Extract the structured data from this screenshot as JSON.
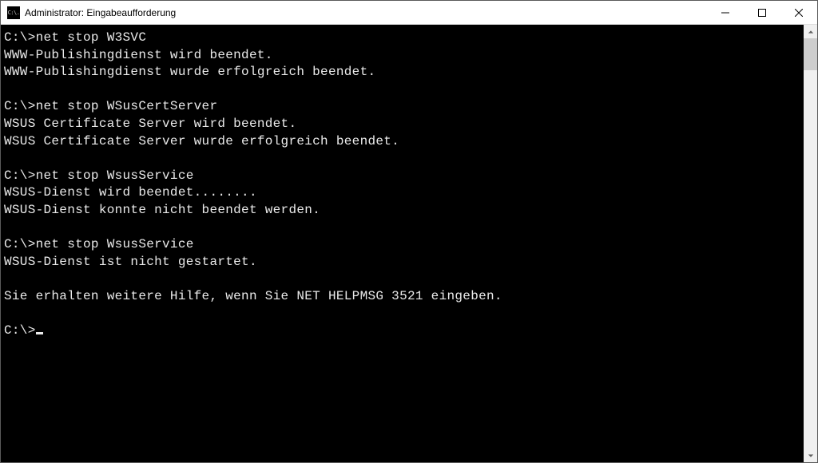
{
  "window": {
    "title": "Administrator: Eingabeaufforderung",
    "icon_text": "C:\\."
  },
  "console": {
    "prompt": "C:\\>",
    "blocks": [
      {
        "command": "net stop W3SVC",
        "output": [
          "WWW-Publishingdienst wird beendet.",
          "WWW-Publishingdienst wurde erfolgreich beendet.",
          ""
        ]
      },
      {
        "command": "net stop WSusCertServer",
        "output": [
          "WSUS Certificate Server wird beendet.",
          "WSUS Certificate Server wurde erfolgreich beendet.",
          ""
        ]
      },
      {
        "command": "net stop WsusService",
        "output": [
          "WSUS-Dienst wird beendet........",
          "WSUS-Dienst konnte nicht beendet werden.",
          ""
        ]
      },
      {
        "command": "net stop WsusService",
        "output": [
          "WSUS-Dienst ist nicht gestartet.",
          "",
          "Sie erhalten weitere Hilfe, wenn Sie NET HELPMSG 3521 eingeben.",
          ""
        ]
      }
    ]
  }
}
